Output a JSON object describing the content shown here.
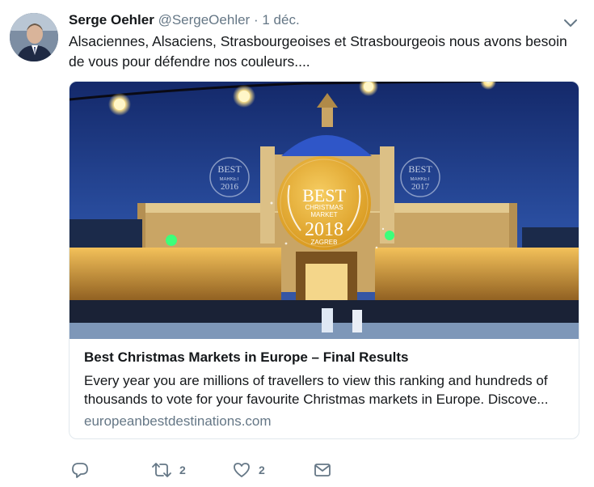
{
  "tweet": {
    "author_name": "Serge Oehler",
    "handle": "@SergeOehler",
    "separator": "·",
    "date": "1 déc.",
    "text": "Alsaciennes, Alsaciens, Strasbourgeoises et Strasbourgeois nous avons besoin de vous pour défendre nos couleurs....",
    "avatar_icon": "user-photo",
    "menu_icon": "chevron-down-icon"
  },
  "card": {
    "title": "Best Christmas Markets in Europe – Final Results",
    "description": "Every year you are millions of travellers to view this ranking and hundreds of thousands to vote for your favourite Christmas markets in Europe. Discove...",
    "domain": "europeanbestdestinations.com",
    "badge": {
      "line1": "BEST",
      "line2": "CHRISTMAS",
      "line3": "MARKET",
      "year": "2018",
      "city": "ZAGREB"
    },
    "badge_left": {
      "line1": "BEST",
      "line2": "MARKET",
      "year": "2016"
    },
    "badge_right": {
      "line1": "BEST",
      "line2": "MARKET",
      "year": "2017"
    }
  },
  "actions": {
    "reply": {
      "icon": "reply-icon",
      "count": ""
    },
    "retweet": {
      "icon": "retweet-icon",
      "count": "2"
    },
    "like": {
      "icon": "heart-icon",
      "count": "2"
    },
    "message": {
      "icon": "envelope-icon",
      "count": ""
    }
  },
  "colors": {
    "text": "#14171a",
    "secondary": "#657786",
    "border": "#e1e8ed",
    "badge_gold": "#e8b23a"
  }
}
